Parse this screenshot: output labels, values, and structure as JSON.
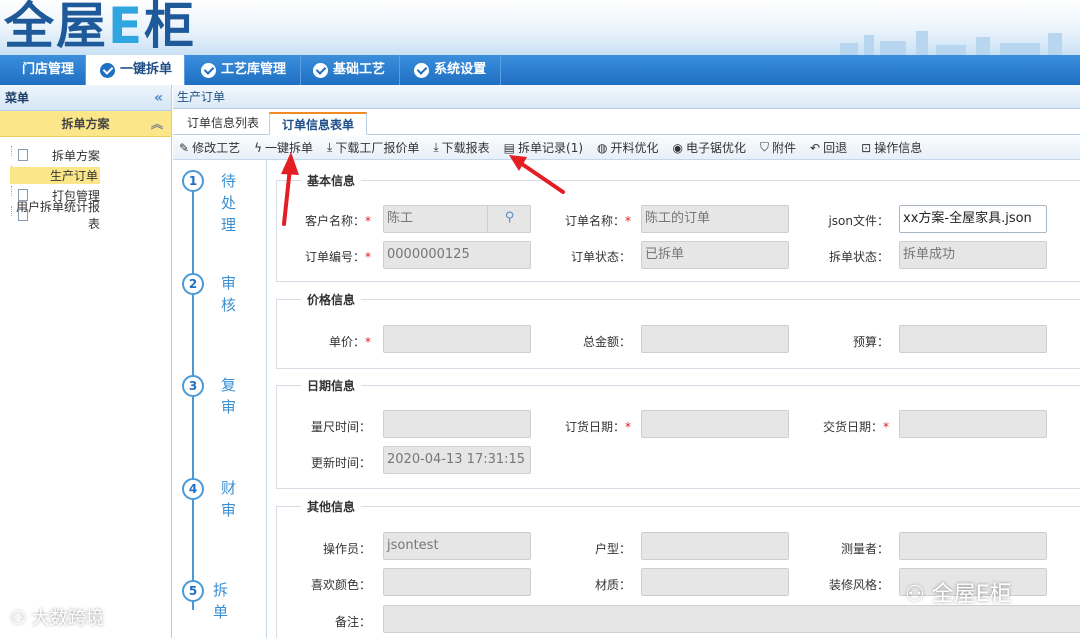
{
  "app": {
    "logo": "全屋E柜"
  },
  "nav": [
    {
      "label": "门店管理",
      "active": false
    },
    {
      "label": "一键拆单",
      "active": true
    },
    {
      "label": "工艺库管理",
      "active": false
    },
    {
      "label": "基础工艺",
      "active": false
    },
    {
      "label": "系统设置",
      "active": false
    }
  ],
  "sidebar": {
    "title": "菜单",
    "group": "拆单方案",
    "items": [
      {
        "label": "拆单方案",
        "active": false
      },
      {
        "label": "生产订单",
        "active": true
      },
      {
        "label": "打包管理",
        "active": false
      },
      {
        "label": "用户拆单统计报表",
        "active": false
      }
    ]
  },
  "breadcrumb": "生产订单",
  "tabs": [
    {
      "label": "订单信息列表",
      "active": false
    },
    {
      "label": "订单信息表单",
      "active": true
    }
  ],
  "toolbar": [
    {
      "label": "修改工艺",
      "icon": "pencil-icon"
    },
    {
      "label": "一键拆单",
      "icon": "lightning-icon"
    },
    {
      "label": "下载工厂报价单",
      "icon": "download-icon"
    },
    {
      "label": "下载报表",
      "icon": "download-icon"
    },
    {
      "label": "拆单记录(1)",
      "icon": "record-icon"
    },
    {
      "label": "开料优化",
      "icon": "optimize-icon"
    },
    {
      "label": "电子锯优化",
      "icon": "saw-icon"
    },
    {
      "label": "附件",
      "icon": "shield-icon"
    },
    {
      "label": "回退",
      "icon": "back-icon"
    },
    {
      "label": "操作信息",
      "icon": "lock-icon"
    }
  ],
  "steps": [
    {
      "num": "1",
      "text": "待处理"
    },
    {
      "num": "2",
      "text": "审核"
    },
    {
      "num": "3",
      "text": "复审"
    },
    {
      "num": "4",
      "text": "财审"
    },
    {
      "num": "5",
      "text": "拆单"
    }
  ],
  "form": {
    "basic": {
      "legend": "基本信息",
      "customer_label": "客户名称：",
      "customer_value": "陈工",
      "order_name_label": "订单名称：",
      "order_name_value": "陈工的订单",
      "json_label": "json文件：",
      "json_value": "xx方案-全屋家具.json",
      "order_no_label": "订单编号：",
      "order_no_value": "0000000125",
      "order_status_label": "订单状态：",
      "order_status_value": "已拆单",
      "split_status_label": "拆单状态：",
      "split_status_value": "拆单成功"
    },
    "price": {
      "legend": "价格信息",
      "unit_price_label": "单价：",
      "unit_price_value": "",
      "total_label": "总金额：",
      "total_value": "",
      "budget_label": "预算：",
      "budget_value": ""
    },
    "date": {
      "legend": "日期信息",
      "measure_time_label": "量尺时间：",
      "measure_time_value": "",
      "order_date_label": "订货日期：",
      "order_date_value": "",
      "delivery_date_label": "交货日期：",
      "delivery_date_value": "",
      "update_time_label": "更新时间：",
      "update_time_value": "2020-04-13 17:31:15"
    },
    "other": {
      "legend": "其他信息",
      "operator_label": "操作员：",
      "operator_value": "jsontest",
      "house_type_label": "户型：",
      "house_type_value": "",
      "measurer_label": "测量者：",
      "measurer_value": "",
      "color_label": "喜欢颜色：",
      "color_value": "",
      "material_label": "材质：",
      "material_value": "",
      "style_label": "装修风格：",
      "style_value": "",
      "remark_label": "备注：",
      "remark_value": ""
    }
  },
  "watermarks": {
    "left": "大数跨境",
    "right": "全屋E柜"
  }
}
